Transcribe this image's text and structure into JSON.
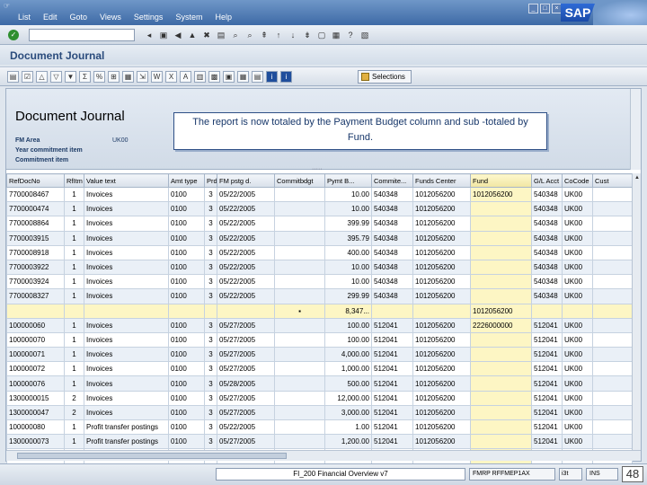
{
  "menubar": {
    "logo": "☞",
    "items": [
      "List",
      "Edit",
      "Goto",
      "Views",
      "Settings",
      "System",
      "Help"
    ],
    "brand": "SAP"
  },
  "app": {
    "title": "Document Journal"
  },
  "appbar": {
    "selections_label": "Selections"
  },
  "report": {
    "title": "Document Journal",
    "fm_area_label": "FM Area",
    "fm_area_value": "UK00",
    "year_label": "Year commitment item",
    "commitment_label": "Commitment item",
    "callout": "The report is now totaled by the Payment Budget column and sub -totaled by Fund."
  },
  "grid": {
    "columns": [
      "RefDocNo",
      "RfItm",
      "Value text",
      "Amt type",
      "Prd",
      "FM pstg d.",
      "Commitbdgt",
      "Pymt B...",
      "Commite...",
      "Funds Center",
      "Fund",
      "G/L Acct",
      "CoCode",
      "Cust"
    ],
    "rows": [
      [
        "7700008467",
        "1",
        "Invoices",
        "0100",
        "3",
        "05/22/2005",
        "",
        "10.00",
        "540348",
        "1012056200",
        "1012056200",
        "540348",
        "UK00",
        ""
      ],
      [
        "7700000474",
        "1",
        "Invoices",
        "0100",
        "3",
        "05/22/2005",
        "",
        "10.00",
        "540348",
        "1012056200",
        "",
        "540348",
        "UK00",
        ""
      ],
      [
        "7700008864",
        "1",
        "Invoices",
        "0100",
        "3",
        "05/22/2005",
        "",
        "399.99",
        "540348",
        "1012056200",
        "",
        "540348",
        "UK00",
        ""
      ],
      [
        "7700003915",
        "1",
        "Invoices",
        "0100",
        "3",
        "05/22/2005",
        "",
        "395.79",
        "540348",
        "1012056200",
        "",
        "540348",
        "UK00",
        ""
      ],
      [
        "7700008918",
        "1",
        "Invoices",
        "0100",
        "3",
        "05/22/2005",
        "",
        "400.00",
        "540348",
        "1012056200",
        "",
        "540348",
        "UK00",
        ""
      ],
      [
        "7700003922",
        "1",
        "Invoices",
        "0100",
        "3",
        "05/22/2005",
        "",
        "10.00",
        "540348",
        "1012056200",
        "",
        "540348",
        "UK00",
        ""
      ],
      [
        "7700003924",
        "1",
        "Invoices",
        "0100",
        "3",
        "05/22/2005",
        "",
        "10.00",
        "540348",
        "1012056200",
        "",
        "540348",
        "UK00",
        ""
      ],
      [
        "7700008327",
        "1",
        "Invoices",
        "0100",
        "3",
        "05/22/2005",
        "",
        "299.99",
        "540348",
        "1012056200",
        "",
        "540348",
        "UK00",
        ""
      ],
      [
        "",
        "",
        "",
        "",
        "",
        "",
        "▪",
        "8,347...",
        "",
        "",
        "1012056200",
        "",
        "",
        ""
      ],
      [
        "100000060",
        "1",
        "Invoices",
        "0100",
        "3",
        "05/27/2005",
        "",
        "100.00",
        "512041",
        "1012056200",
        "2226000000",
        "512041",
        "UK00",
        ""
      ],
      [
        "100000070",
        "1",
        "Invoices",
        "0100",
        "3",
        "05/27/2005",
        "",
        "100.00",
        "512041",
        "1012056200",
        "",
        "512041",
        "UK00",
        ""
      ],
      [
        "100000071",
        "1",
        "Invoices",
        "0100",
        "3",
        "05/27/2005",
        "",
        "4,000.00",
        "512041",
        "1012056200",
        "",
        "512041",
        "UK00",
        ""
      ],
      [
        "100000072",
        "1",
        "Invoices",
        "0100",
        "3",
        "05/27/2005",
        "",
        "1,000.00",
        "512041",
        "1012056200",
        "",
        "512041",
        "UK00",
        ""
      ],
      [
        "100000076",
        "1",
        "Invoices",
        "0100",
        "3",
        "05/28/2005",
        "",
        "500.00",
        "512041",
        "1012056200",
        "",
        "512041",
        "UK00",
        ""
      ],
      [
        "1300000015",
        "2",
        "Invoices",
        "0100",
        "3",
        "05/27/2005",
        "",
        "12,000.00",
        "512041",
        "1012056200",
        "",
        "512041",
        "UK00",
        ""
      ],
      [
        "1300000047",
        "2",
        "Invoices",
        "0100",
        "3",
        "05/27/2005",
        "",
        "3,000.00",
        "512041",
        "1012056200",
        "",
        "512041",
        "UK00",
        ""
      ],
      [
        "100000080",
        "1",
        "Profit transfer postings",
        "0100",
        "3",
        "05/22/2005",
        "",
        "1.00",
        "512041",
        "1012056200",
        "",
        "512041",
        "UK00",
        ""
      ],
      [
        "1300000073",
        "1",
        "Profit transfer postings",
        "0100",
        "3",
        "05/27/2005",
        "",
        "1,200.00",
        "512041",
        "1012056200",
        "",
        "512041",
        "UK00",
        ""
      ],
      [
        "1300000073",
        "2",
        "Profit transfer postings",
        "0100",
        "3",
        "05/27/2005",
        "",
        "1,200.00",
        "512041",
        "1012056200",
        "",
        "512041",
        "UK00",
        ""
      ],
      [
        "1300000074",
        "1",
        "Profit transfer postings",
        "0100",
        "3",
        "05/27/2005",
        "",
        "1,500.00",
        "512041",
        "1012056200",
        "",
        "512041",
        "UK00",
        ""
      ]
    ]
  },
  "status": {
    "center": "FI_200 Financial Overview v7",
    "system": "FMRP  RFFMEP1AX",
    "client": "i3t",
    "mode": "INS",
    "slide": "48"
  }
}
